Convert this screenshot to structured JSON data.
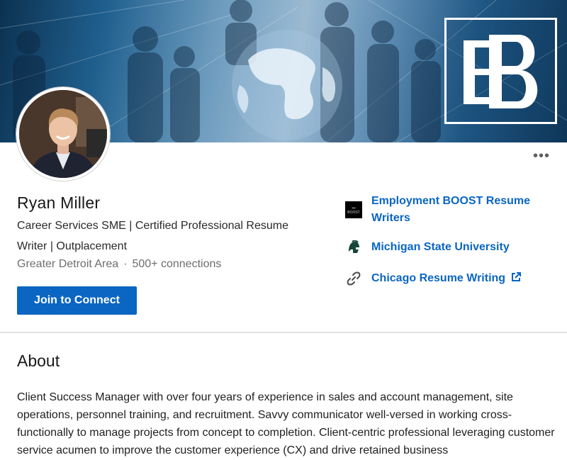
{
  "profile": {
    "name": "Ryan Miller",
    "headline": "Career Services SME | Certified Professional Resume Writer | Outplacement",
    "location": "Greater Detroit Area",
    "separator": "·",
    "connections": "500+ connections",
    "connect_label": "Join to Connect",
    "more_label": "•••"
  },
  "side_links": [
    {
      "label": "Employment BOOST Resume Writers",
      "icon": "company-logo-icon"
    },
    {
      "label": "Michigan State University",
      "icon": "spartan-helmet-icon"
    },
    {
      "label": "Chicago Resume Writing",
      "icon": "link-icon",
      "external_icon": "external-link-icon"
    }
  ],
  "about": {
    "title": "About",
    "text": "Client Success Manager with over four years of experience in sales and account management, site operations, personnel training, and recruitment. Savvy communicator well-versed in working cross-functionally to manage projects from concept to completion. Client-centric professional leveraging customer service acumen to improve the customer experience (CX) and drive retained business"
  },
  "colors": {
    "link": "#0a66c2",
    "button": "#0a66c2",
    "banner": "#1f5683"
  }
}
